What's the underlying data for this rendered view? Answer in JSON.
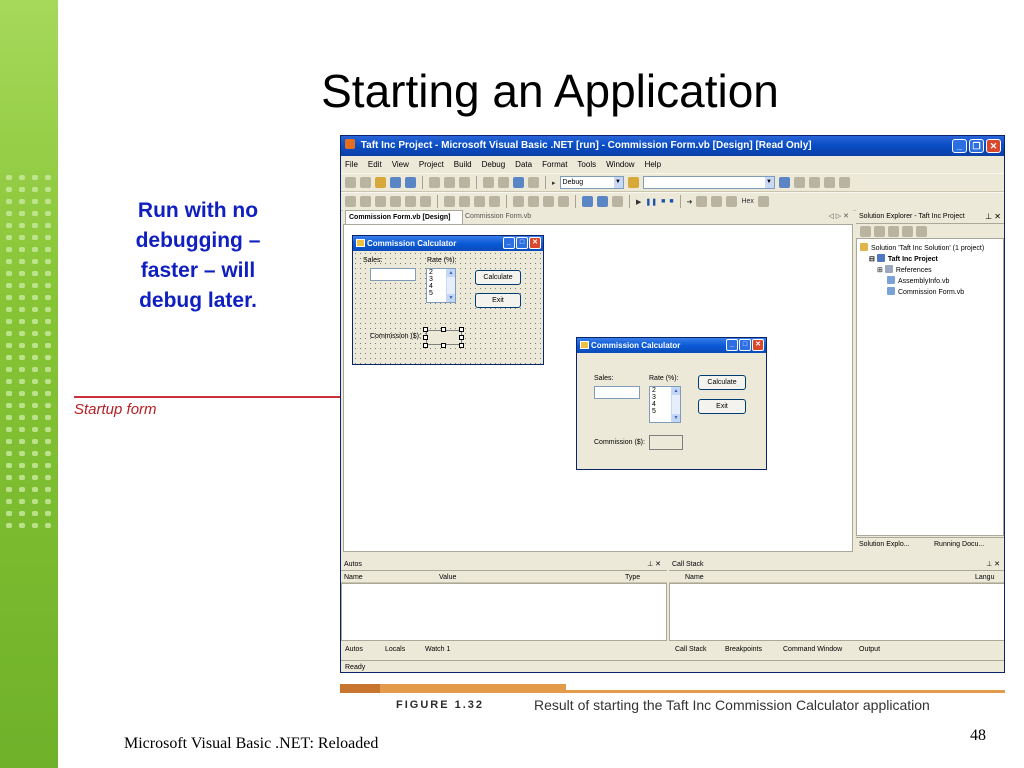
{
  "slide": {
    "title": "Starting an Application",
    "note_lines": [
      "Run with no",
      "debugging –",
      "faster – will",
      "debug later."
    ],
    "startup_label": "Startup form",
    "figure_label": "FIGURE 1.32",
    "figure_caption": "Result of starting the Taft Inc Commission Calculator application",
    "footer_left": "Microsoft Visual Basic .NET: Reloaded",
    "page_number": "48"
  },
  "ide": {
    "title": "Taft Inc Project - Microsoft Visual Basic .NET [run] - Commission Form.vb [Design] [Read Only]",
    "menu": [
      "File",
      "Edit",
      "View",
      "Project",
      "Build",
      "Debug",
      "Data",
      "Format",
      "Tools",
      "Window",
      "Help"
    ],
    "config_combo": "Debug",
    "hex_label": "Hex",
    "doc_tabs": [
      "Commission Form.vb [Design]",
      "Commission Form.vb"
    ],
    "doc_tab_controls": "◁ ▷ ✕",
    "solution_explorer": {
      "title": "Solution Explorer - Taft Inc Project",
      "items": [
        "Solution 'Taft Inc Solution' (1 project)",
        "Taft Inc Project",
        "References",
        "AssemblyInfo.vb",
        "Commission Form.vb"
      ],
      "tabs": [
        "Solution Explo...",
        "Running Docu..."
      ]
    },
    "autos": {
      "title": "Autos",
      "columns": [
        "Name",
        "Value",
        "Type"
      ],
      "tabs": [
        "Autos",
        "Locals",
        "Watch 1"
      ]
    },
    "call_stack": {
      "title": "Call Stack",
      "columns": [
        "Name",
        "Langu"
      ],
      "tabs": [
        "Call Stack",
        "Breakpoints",
        "Command Window",
        "Output"
      ]
    },
    "status": "Ready"
  },
  "design_form": {
    "title": "Commission Calculator",
    "sales_label": "Sales:",
    "rate_label": "Rate (%):",
    "rate_items": [
      "2",
      "3",
      "4",
      "5"
    ],
    "calculate_button": "Calculate",
    "exit_button": "Exit",
    "commission_label": "Commission ($):"
  },
  "run_form": {
    "title": "Commission Calculator",
    "sales_label": "Sales:",
    "rate_label": "Rate (%):",
    "rate_items": [
      "2",
      "3",
      "4",
      "5"
    ],
    "calculate_button": "Calculate",
    "exit_button": "Exit",
    "commission_label": "Commission ($):"
  },
  "colors": {
    "title_bar": "#0a4ec6",
    "note_text": "#1020c0",
    "startup_line": "#c8323a",
    "figure_bar": "#e39a4a",
    "left_strip": "#8fcc3c"
  }
}
